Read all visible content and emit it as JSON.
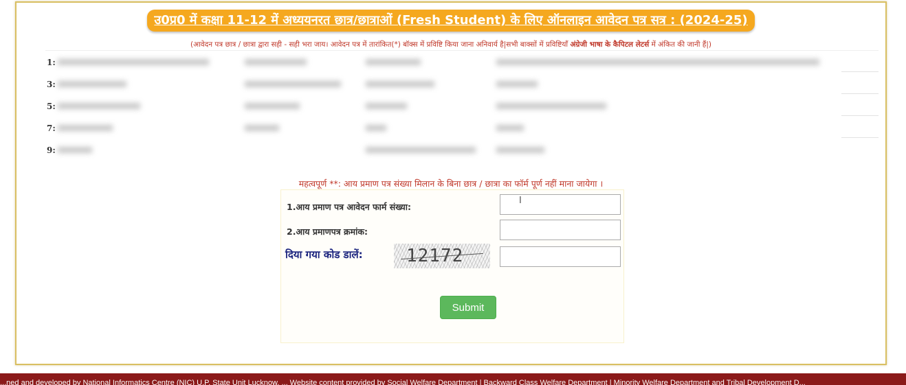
{
  "header": {
    "title": "उ0प्र0 में कक्षा 11-12 में अध्ययनरत छात्र/छात्राओं (Fresh Student) के लिए ऑनलाइन आवेदन पत्र सत्र : (2024-25)",
    "instruction_part1": "(आवेदन पत्र छात्र / छात्रा द्वारा सही - सही भरा जाय। आवेदन पत्र में तारांकित(*) बॉक्स में प्रविष्टि किया जाना अनिवार्य है|सभी बाक्सों में प्रविष्टियाँ ",
    "instruction_bold": "अंग्रेजी भाषा के कैपिटल लेटर्स",
    "instruction_part2": " में अंकित की जानी हैं|)"
  },
  "blurred_rows": [
    {
      "num": "1:"
    },
    {
      "num": "3:"
    },
    {
      "num": "5:"
    },
    {
      "num": "7:"
    },
    {
      "num": "9:"
    }
  ],
  "form": {
    "important_note": "महत्वपूर्ण **: आय प्रमाण पत्र संख्या मिलान के बिना छात्र / छात्रा का फॉर्म पूर्ण नहीं माना जायेगा ।",
    "field1_label": "1.आय प्रमाण पत्र आवेदन फार्म संख्या:",
    "field1_value": "",
    "field2_label": "2.आय प्रमाणपत्र क्रमांक:",
    "field2_value": "",
    "captcha_label": "दिया गया कोड डालें:",
    "captcha_code": "12172",
    "captcha_value": "",
    "submit_label": "Submit"
  },
  "footer": {
    "text": "...ned and developed by National Informatics Centre (NIC) U.P. State Unit Lucknow. ... Website content provided by Social Welfare Department | Backward Class Welfare Department | Minority Welfare Department and Tribal Development D..."
  },
  "colors": {
    "title_bg": "#f5a81f",
    "accent_red": "#c0392b",
    "submit_green": "#5cb85c",
    "footer_bg": "#8b1a1a",
    "captcha_label": "#1a237e"
  }
}
